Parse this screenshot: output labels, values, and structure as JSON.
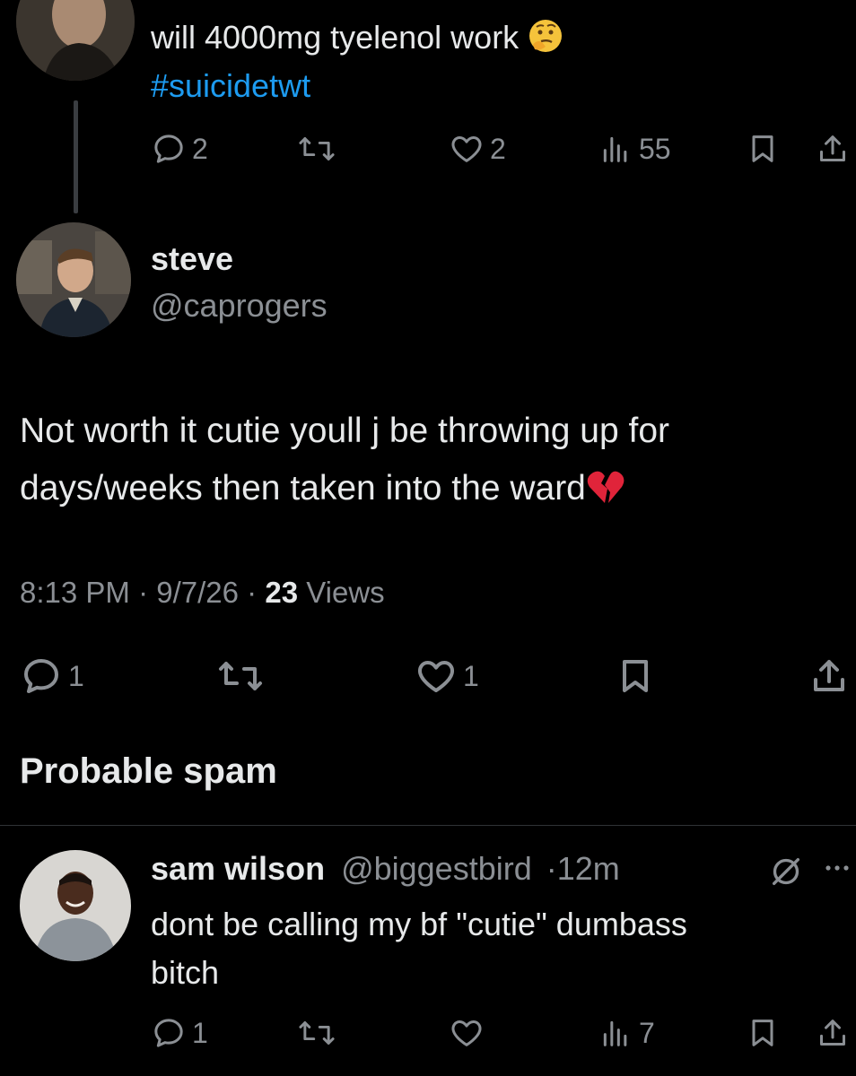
{
  "tweet1": {
    "text": "will 4000mg tyelenol work",
    "emoji": "thinking-face",
    "hashtag": "#suicidetwt",
    "replies": "2",
    "likes": "2",
    "views": "55"
  },
  "tweet2": {
    "display_name": "steve",
    "handle": "@caprogers",
    "text_line1": "Not worth it cutie youll j be throwing up for",
    "text_line2": "days/weeks then taken into the ward",
    "emoji": "broken-heart",
    "time": "8:13 PM",
    "date": "9/7/26",
    "views_count": "23",
    "views_label": "Views",
    "replies": "1",
    "likes": "1"
  },
  "spam_label": "Probable spam",
  "tweet3": {
    "display_name": "sam wilson",
    "handle": "@biggestbird",
    "time_ago": "12m",
    "text_line1": "dont be calling my bf \"cutie\" dumbass",
    "text_line2": "bitch",
    "replies": "1",
    "views": "7"
  },
  "colors": {
    "background": "#000000",
    "text": "#e7e9ea",
    "muted": "#8b8f94",
    "link": "#1d9bf0"
  }
}
